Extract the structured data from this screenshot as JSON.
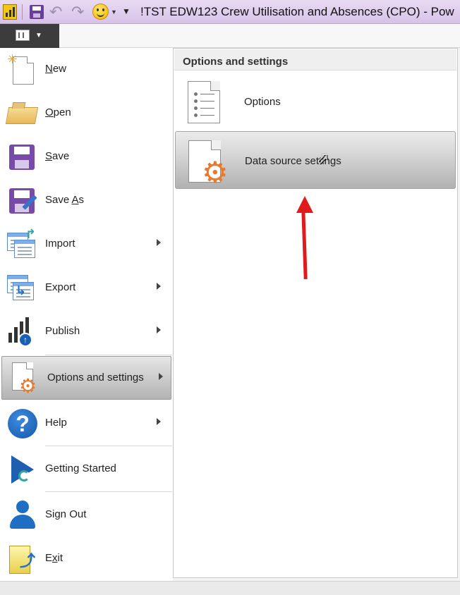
{
  "titlebar": {
    "title": "!TST EDW123 Crew Utilisation and Absences (CPO) - Pow"
  },
  "menu": {
    "items": [
      {
        "label_parts": [
          "",
          "N",
          "ew"
        ],
        "icon": "new-file-icon"
      },
      {
        "label_parts": [
          "",
          "O",
          "pen"
        ],
        "icon": "folder-icon"
      },
      {
        "label_parts": [
          "",
          "S",
          "ave"
        ],
        "icon": "save-icon"
      },
      {
        "label_parts": [
          "Save ",
          "A",
          "s"
        ],
        "icon": "save-as-icon"
      },
      {
        "label": "Import",
        "icon": "import-icon"
      },
      {
        "label": "Export",
        "icon": "export-icon"
      },
      {
        "label": "Publish",
        "icon": "publish-icon"
      },
      {
        "label": "Options and settings",
        "icon": "options-settings-icon"
      },
      {
        "label": "Help",
        "icon": "help-icon"
      },
      {
        "label": "Getting Started",
        "icon": "getting-started-icon"
      },
      {
        "label": "Sign Out",
        "icon": "sign-out-icon"
      },
      {
        "label_parts": [
          "E",
          "x",
          "it"
        ],
        "icon": "exit-icon"
      }
    ]
  },
  "panel": {
    "header": "Options and settings",
    "items": [
      {
        "label": "Options",
        "icon": "options-list-icon"
      },
      {
        "label": "Data source settings",
        "icon": "data-source-settings-icon"
      }
    ]
  },
  "colors": {
    "titlebar": "#d7c2e8",
    "accent_gear": "#e8792d",
    "annotation_arrow": "#e01b1b"
  }
}
